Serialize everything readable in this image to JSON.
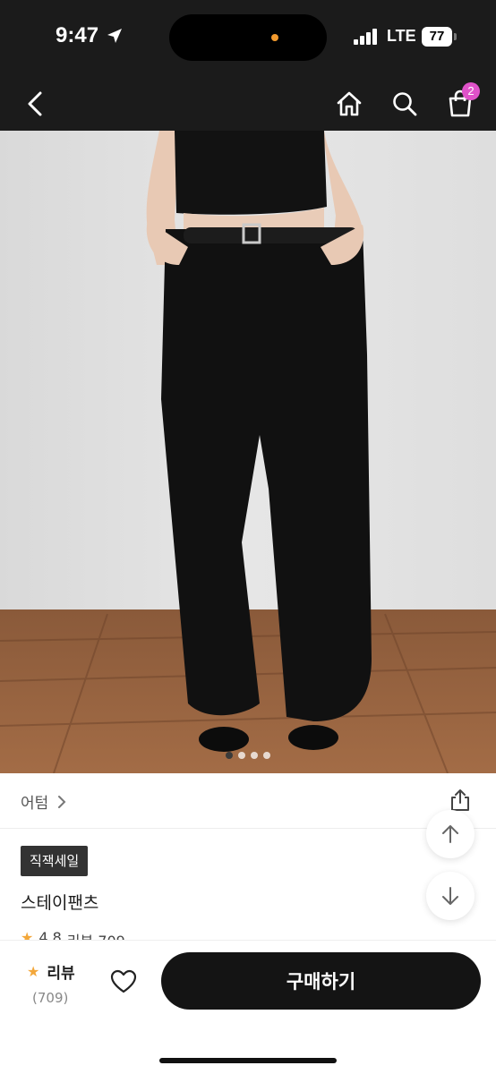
{
  "status_bar": {
    "time": "9:47",
    "network": "LTE",
    "battery": "77"
  },
  "nav": {
    "cart_count": "2"
  },
  "product": {
    "carousel_total": 4,
    "carousel_active": 1,
    "brand": "어텀",
    "tag": "직잭세일",
    "name": "스테이팬츠",
    "rating_peek": "4.8",
    "review_peek": "리뷰 709"
  },
  "bottom_bar": {
    "review_label": "리뷰",
    "review_count": "(709)",
    "buy_label": "구매하기"
  },
  "colors": {
    "header_bg": "#1b1b1b",
    "badge": "#e052c9",
    "star": "#f3a73a",
    "buy_button": "#141414"
  }
}
